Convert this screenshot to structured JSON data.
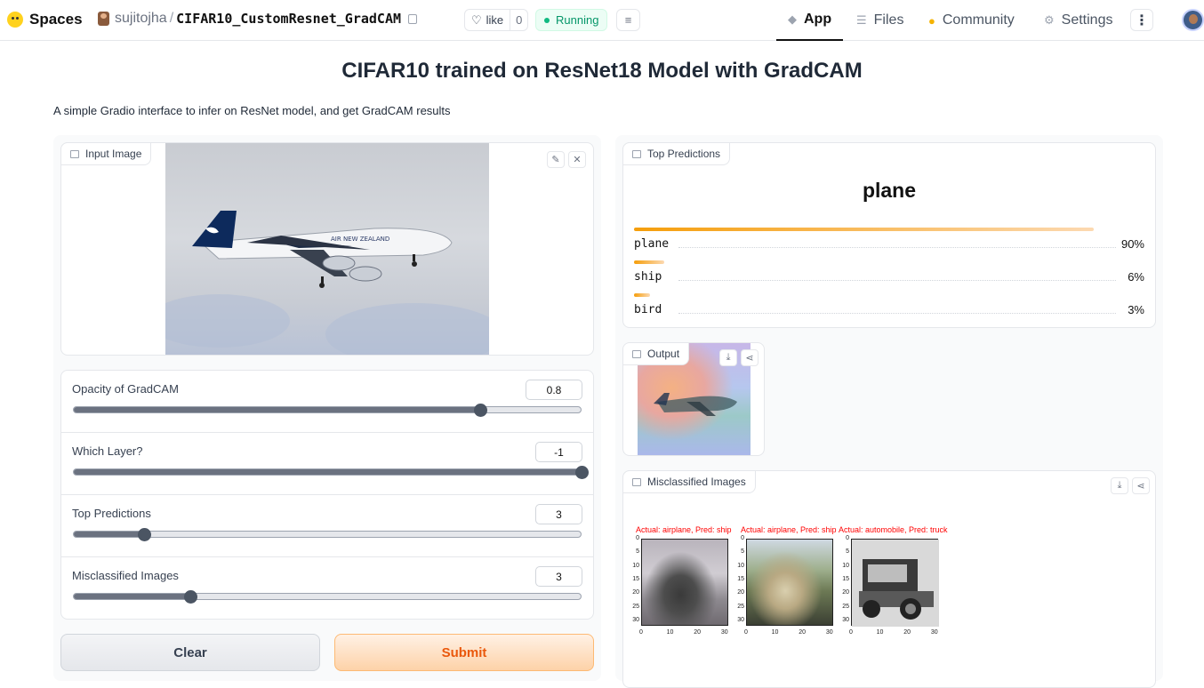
{
  "header": {
    "brand": "Spaces",
    "user": "sujitojha",
    "separator": "/",
    "repo": "CIFAR10_CustomResnet_GradCAM",
    "like_label": "like",
    "like_count": "0",
    "status": "Running",
    "nav": [
      {
        "label": "App",
        "icon": "app-icon"
      },
      {
        "label": "Files",
        "icon": "files-icon"
      },
      {
        "label": "Community",
        "icon": "community-icon"
      },
      {
        "label": "Settings",
        "icon": "gear-icon"
      }
    ]
  },
  "app": {
    "title": "CIFAR10 trained on ResNet18 Model with GradCAM",
    "description": "A simple Gradio interface to infer on ResNet model, and get GradCAM results"
  },
  "input_image": {
    "label": "Input Image",
    "photo_text": "AIR NEW ZEALAND"
  },
  "sliders": [
    {
      "label": "Opacity of GradCAM",
      "value": "0.8",
      "fraction": 0.8
    },
    {
      "label": "Which Layer?",
      "value": "-1",
      "fraction": 1.0
    },
    {
      "label": "Top Predictions",
      "value": "3",
      "fraction": 0.14
    },
    {
      "label": "Misclassified Images",
      "value": "3",
      "fraction": 0.23
    }
  ],
  "buttons": {
    "clear": "Clear",
    "submit": "Submit"
  },
  "predictions": {
    "label": "Top Predictions",
    "top": "plane",
    "items": [
      {
        "name": "plane",
        "pct": "90%",
        "fraction": 0.9
      },
      {
        "name": "ship",
        "pct": "6%",
        "fraction": 0.06
      },
      {
        "name": "bird",
        "pct": "3%",
        "fraction": 0.03
      }
    ]
  },
  "output": {
    "label": "Output"
  },
  "misclassified": {
    "label": "Misclassified Images",
    "images": [
      {
        "caption": "Actual: airplane, Pred: ship"
      },
      {
        "caption": "Actual: airplane, Pred: ship"
      },
      {
        "caption": "Actual: automobile, Pred: truck"
      }
    ],
    "y_ticks": [
      "0",
      "5",
      "10",
      "15",
      "20",
      "25",
      "30"
    ],
    "x_ticks": [
      "0",
      "10",
      "20",
      "30"
    ]
  },
  "colors": {
    "accent": "#ea580c",
    "running": "#059669",
    "caption": "#ff0000"
  }
}
